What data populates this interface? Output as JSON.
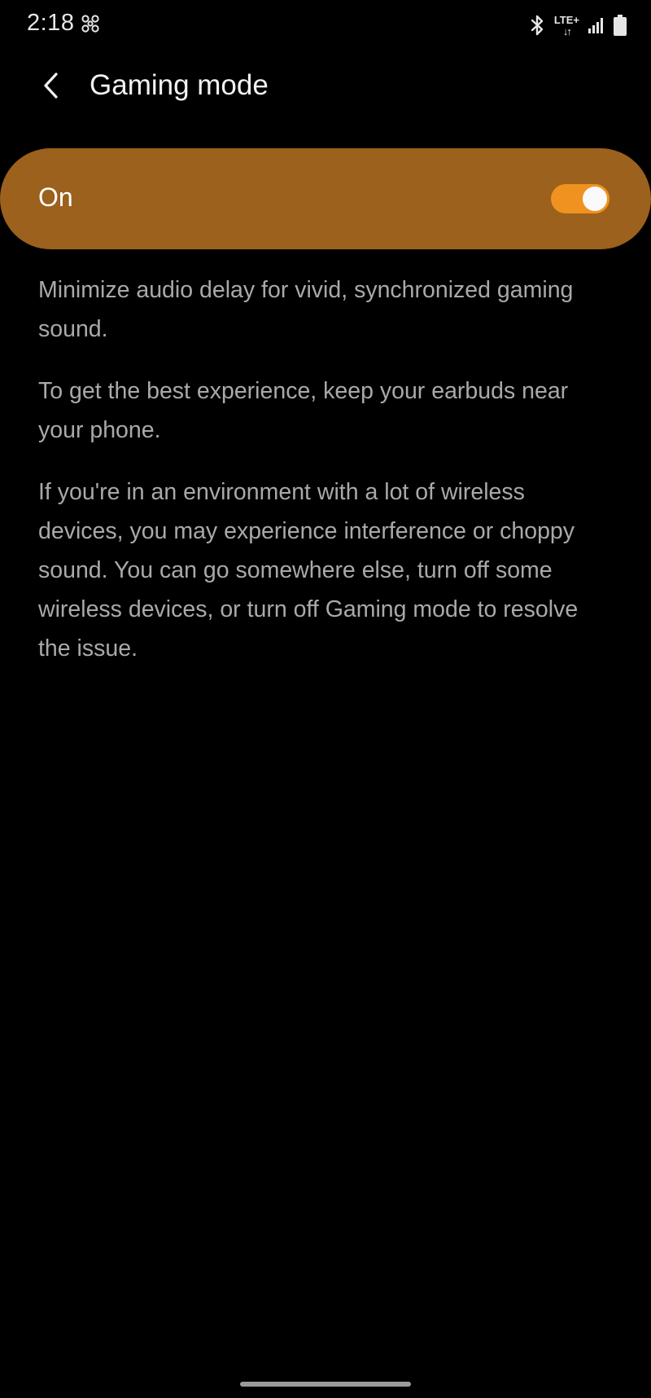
{
  "status_bar": {
    "time": "2:18",
    "left_icon": "pinwheel-notification-icon",
    "network": "LTE+",
    "network_arrows": "↓↑",
    "icons": [
      "bluetooth-icon",
      "lte-plus-icon",
      "signal-icon",
      "battery-icon"
    ]
  },
  "header": {
    "back_icon": "chevron-left-icon",
    "title": "Gaming mode"
  },
  "toggle": {
    "label": "On",
    "state": true,
    "card_color": "#9b611d",
    "track_color": "#f0921f"
  },
  "descriptions": [
    "Minimize audio delay for vivid, synchronized gaming sound.",
    "To get the best experience, keep your earbuds near your phone.",
    "If you're in an environment with a lot of wireless devices, you may experience interference or choppy sound. You can go somewhere else, turn off some wireless devices, or turn off Gaming mode to resolve the issue."
  ],
  "colors": {
    "background": "#000000",
    "text_primary": "#f2f2f2",
    "text_secondary": "#a9a9a9"
  }
}
